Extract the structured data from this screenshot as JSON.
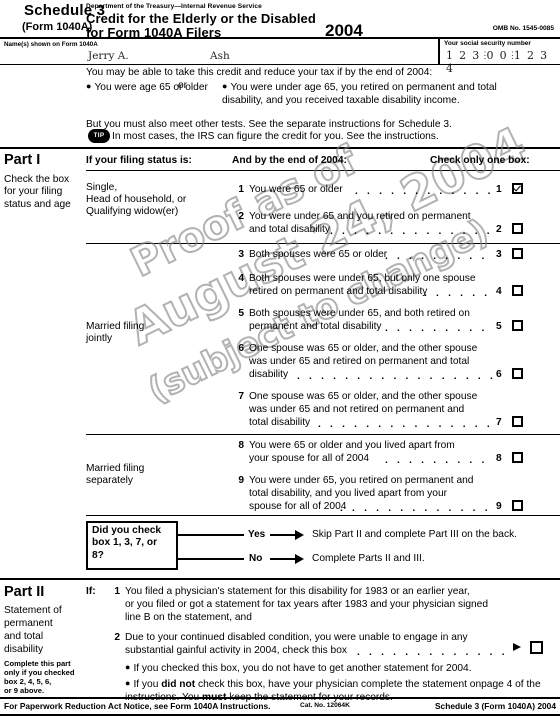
{
  "header": {
    "schedule": "Schedule 3",
    "form_ref": "(Form 1040A)",
    "department": "Department of the Treasury—Internal Revenue Service",
    "title_line1": "Credit for the Elderly or the Disabled",
    "title_line2": "for Form 1040A Filers",
    "year": "2004",
    "omb": "OMB No. 1545-0085"
  },
  "name_row": {
    "label": "Name(s) shown on Form 1040A",
    "first_name": "Jerry A.",
    "last_name": "Ash",
    "ssn_label": "Your social security number",
    "ssn_group1": "1 2 3",
    "ssn_group2": "0 0",
    "ssn_group3": "1 2 3 4"
  },
  "intro": {
    "line1": "You may be able to take this credit and reduce your tax if by the end of 2004:",
    "bullet_left": "You were age 65 or older",
    "or": "or",
    "bullet_right": "You were under age 65, you retired on permanent and total disability, and you received taxable disability income.",
    "line3": "But you must also meet other tests. See the separate instructions for Schedule 3.",
    "tip_icon_label": "TIP",
    "tip_text": "In most cases, the IRS can figure the credit for you. See the instructions."
  },
  "part1": {
    "label": "Part I",
    "subtitle": "Check the box for your filing status and age",
    "col_status": "If your filing status is:",
    "col_end": "And by the end of 2004:",
    "col_check": "Check only one box:",
    "status_single": "Single, Head of household, or Qualifying widow(er)",
    "status_single_l1": "Single,",
    "status_single_l2": "Head of household, or",
    "status_single_l3": "Qualifying widow(er)",
    "status_joint_l1": "Married filing",
    "status_joint_l2": "jointly",
    "status_sep_l1": "Married filing",
    "status_sep_l2": "separately",
    "rows": [
      {
        "num": "1",
        "l1": "You were 65 or older",
        "l2": "",
        "l3": "",
        "checked": true
      },
      {
        "num": "2",
        "l1": "You were under 65 and you retired on permanent",
        "l2": "and total disability",
        "l3": "",
        "checked": false
      },
      {
        "num": "3",
        "l1": "Both spouses were 65 or older",
        "l2": "",
        "l3": "",
        "checked": false
      },
      {
        "num": "4",
        "l1": "Both spouses were under 65, but only one spouse",
        "l2": "retired on permanent and total disability",
        "l3": "",
        "checked": false
      },
      {
        "num": "5",
        "l1": "Both spouses were under 65, and both retired on",
        "l2": "permanent and total disability",
        "l3": "",
        "checked": false
      },
      {
        "num": "6",
        "l1": "One spouse was 65 or older, and the other spouse",
        "l2": "was under 65 and retired on permanent and total",
        "l3": "disability",
        "checked": false
      },
      {
        "num": "7",
        "l1": "One spouse was 65 or older, and the other spouse",
        "l2": "was under 65 and not retired on permanent and",
        "l3": "total disability",
        "checked": false
      },
      {
        "num": "8",
        "l1": "You were 65 or older and you lived apart from",
        "l2": "your spouse for all of 2004",
        "l3": "",
        "checked": false
      },
      {
        "num": "9",
        "l1": "You were under 65, you retired on permanent and",
        "l2": "total disability, and you lived apart from your",
        "l3": "spouse for all of 2004",
        "checked": false
      }
    ]
  },
  "decision": {
    "question_l1": "Did you check",
    "question_l2": "box 1, 3, 7, or",
    "question_l3": "8?",
    "yes_label": "Yes",
    "yes_text": "Skip Part II and complete Part III on the back.",
    "no_label": "No",
    "no_text": "Complete Parts II and III."
  },
  "part2": {
    "label": "Part II",
    "subtitle_l1": "Statement of",
    "subtitle_l2": "permanent",
    "subtitle_l3": "and total",
    "subtitle_l4": "disability",
    "note_l1": "Complete this part",
    "note_l2": "only if you checked",
    "note_l3": "box 2, 4, 5, 6,",
    "note_l4": "or 9 above.",
    "if_label": "If:",
    "item1_num": "1",
    "item1_l1": "You filed a physician's statement for this disability for 1983 or an earlier year,",
    "item1_l2": "or you filed or got a statement for tax years after 1983 and your physician signed",
    "item1_l3": "line B on the statement, and",
    "item2_num": "2",
    "item2_l1": "Due to your continued disabled condition, you were unable to engage in any",
    "item2_l2": "substantial gainful activity in 2004, check this box",
    "item2_checked": false,
    "bullet1": "If you checked this box, you do not have to get another statement for 2004.",
    "bullet2_a": "If you ",
    "bullet2_b": "did not",
    "bullet2_c": " check this box, have your physician complete the statement on",
    "bullet2_d": "page 4 of the instructions. You ",
    "bullet2_e": "must",
    "bullet2_f": " keep the statement for your records."
  },
  "footer": {
    "left": "For Paperwork Reduction Act Notice, see Form 1040A Instructions.",
    "center": "Cat. No. 12064K",
    "right": "Schedule 3 (Form 1040A) 2004"
  },
  "watermark": {
    "line1": "Proof as of",
    "line2": "August 24, 2004",
    "line3": "(subject to change)"
  }
}
